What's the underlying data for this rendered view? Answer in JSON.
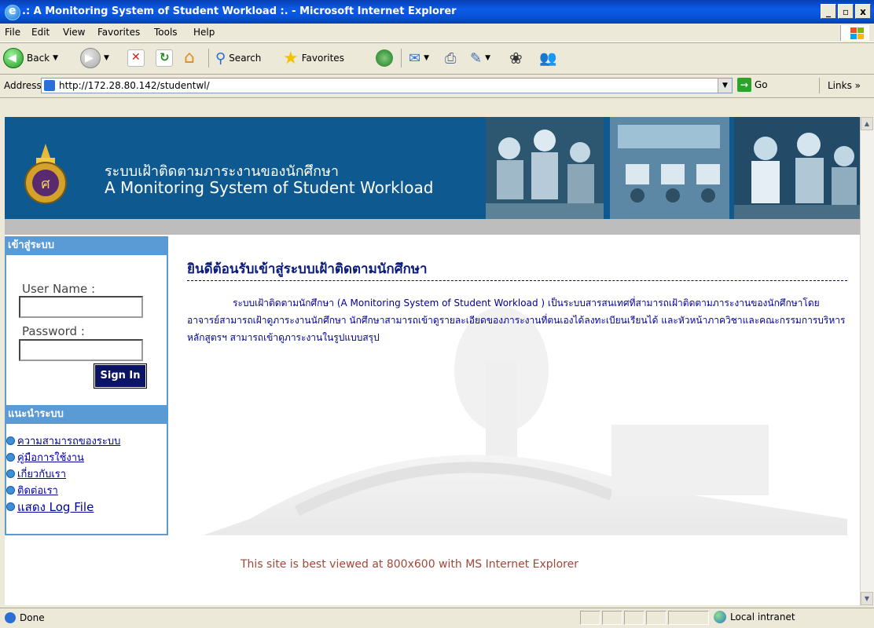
{
  "window": {
    "title": ".: A Monitoring System of Student Workload :. - Microsoft Internet Explorer",
    "buttons": [
      "_",
      "▫",
      "x"
    ]
  },
  "menu": [
    "File",
    "Edit",
    "View",
    "Favorites",
    "Tools",
    "Help"
  ],
  "toolbar": {
    "back": "Back",
    "search": "Search",
    "favorites": "Favorites"
  },
  "address": {
    "label": "Address",
    "url": "http://172.28.80.142/studentwl/",
    "go": "Go",
    "links": "Links"
  },
  "banner": {
    "title_th": "ระบบเฝ้าติดตามภาระงานของนักศึกษา",
    "title_en": "A Monitoring System of Student Workload"
  },
  "login": {
    "header": "เข้าสู่ระบบ",
    "username_label": "User Name :",
    "password_label": "Password :",
    "username_value": "",
    "password_value": "",
    "signin": "Sign In"
  },
  "guide": {
    "header": "แนะนำระบบ",
    "items": [
      "ความสามารถของระบบ",
      "คู่มือการใช้งาน",
      "เกี่ยวกับเรา",
      "ติดต่อเรา",
      "แสดง Log File"
    ]
  },
  "main": {
    "welcome": "ยินดีต้อนรับเข้าสู่ระบบเฝ้าติดตามนักศึกษา",
    "description": "ระบบเฝ้าติดตามนักศึกษา (A Monitoring System of Student Workload ) เป็นระบบสารสนเทศที่สามารถเฝ้าติดตามภาระงานของนักศึกษาโดยอาจารย์สามารถเฝ้าดูภาระงานนักศึกษา นักศึกษาสามารถเข้าดูรายละเอียดของภาระงานที่ตนเองได้ลงทะเบียนเรียนได้ และหัวหน้าภาควิชาและคณะกรรมการบริหารหลักสูตรฯ สามารถเข้าดูภาระงานในรูปแบบสรุป"
  },
  "footer": {
    "note": "This site is best viewed at 800x600 with MS Internet Explorer"
  },
  "status": {
    "left": "Done",
    "zone": "Local intranet"
  },
  "colors": {
    "banner": "#0e5a90",
    "sidebar_header": "#5b9bd5",
    "link": "#00009c",
    "footer_note": "#a0483a"
  }
}
